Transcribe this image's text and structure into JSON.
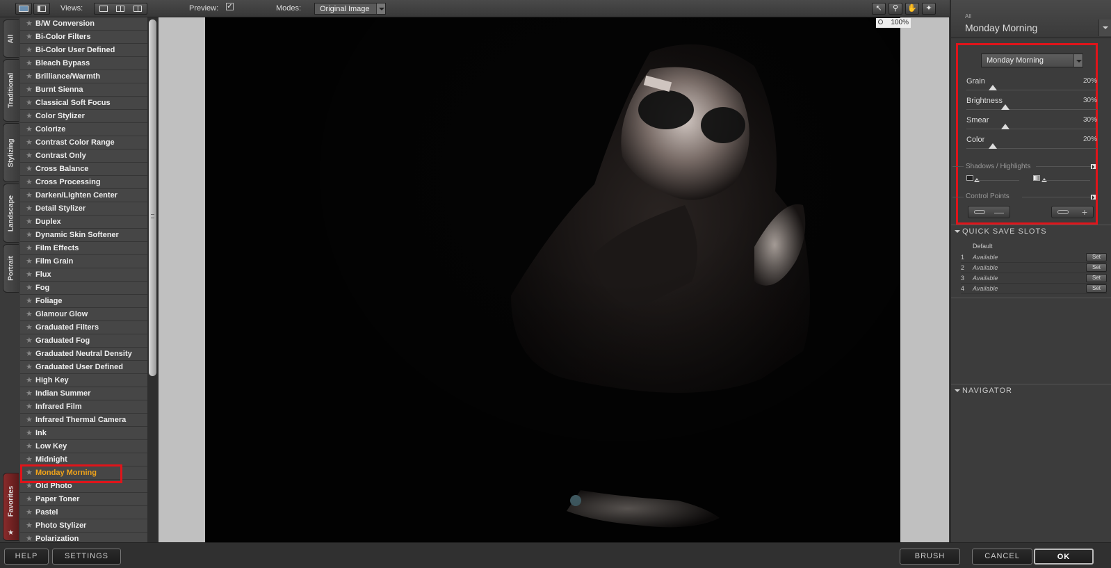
{
  "toolbar": {
    "views_label": "Views:",
    "preview_label": "Preview:",
    "preview_check": "✓",
    "modes_label": "Modes:",
    "modes_value": "Original Image",
    "tools": [
      "↖",
      "⚲",
      "✋",
      "✦"
    ],
    "zoom": "100%"
  },
  "tabs": [
    "All",
    "Traditional",
    "Stylizing",
    "Landscape",
    "Portrait"
  ],
  "favorites_tab": "Favorites",
  "favorites_star": "★",
  "filters": [
    "B/W Conversion",
    "Bi-Color Filters",
    "Bi-Color User Defined",
    "Bleach Bypass",
    "Brilliance/Warmth",
    "Burnt Sienna",
    "Classical Soft Focus",
    "Color Stylizer",
    "Colorize",
    "Contrast Color Range",
    "Contrast Only",
    "Cross Balance",
    "Cross Processing",
    "Darken/Lighten Center",
    "Detail Stylizer",
    "Duplex",
    "Dynamic Skin Softener",
    "Film Effects",
    "Film Grain",
    "Flux",
    "Fog",
    "Foliage",
    "Glamour Glow",
    "Graduated Filters",
    "Graduated Fog",
    "Graduated Neutral Density",
    "Graduated User Defined",
    "High Key",
    "Indian Summer",
    "Infrared Film",
    "Infrared Thermal Camera",
    "Ink",
    "Low Key",
    "Midnight",
    "Monday Morning",
    "Old Photo",
    "Paper Toner",
    "Pastel",
    "Photo Stylizer",
    "Polarization"
  ],
  "selected_filter": "Monday Morning",
  "panel": {
    "category": "All",
    "title": "Monday Morning",
    "preset": "Monday Morning",
    "sliders": [
      {
        "label": "Grain",
        "value": "20%",
        "level": 0.2
      },
      {
        "label": "Brightness",
        "value": "30%",
        "level": 0.3
      },
      {
        "label": "Smear",
        "value": "30%",
        "level": 0.3
      },
      {
        "label": "Color",
        "value": "20%",
        "level": 0.2
      }
    ],
    "shadows_label": "Shadows / Highlights",
    "control_points_label": "Control Points",
    "cp_minus": "—",
    "cp_plus": "+",
    "quick_save_title": "QUICK SAVE SLOTS",
    "quick_save_default": "Default",
    "slots": [
      {
        "num": "1",
        "status": "Available",
        "button": "Set"
      },
      {
        "num": "2",
        "status": "Available",
        "button": "Set"
      },
      {
        "num": "3",
        "status": "Available",
        "button": "Set"
      },
      {
        "num": "4",
        "status": "Available",
        "button": "Set"
      }
    ],
    "navigator_title": "NAVIGATOR"
  },
  "bottom": {
    "help": "HELP",
    "settings": "SETTINGS",
    "brush": "BRUSH",
    "cancel": "CANCEL",
    "ok": "OK"
  },
  "colors": {
    "highlight": "#e0141a",
    "selected_text": "#f0a31a"
  }
}
